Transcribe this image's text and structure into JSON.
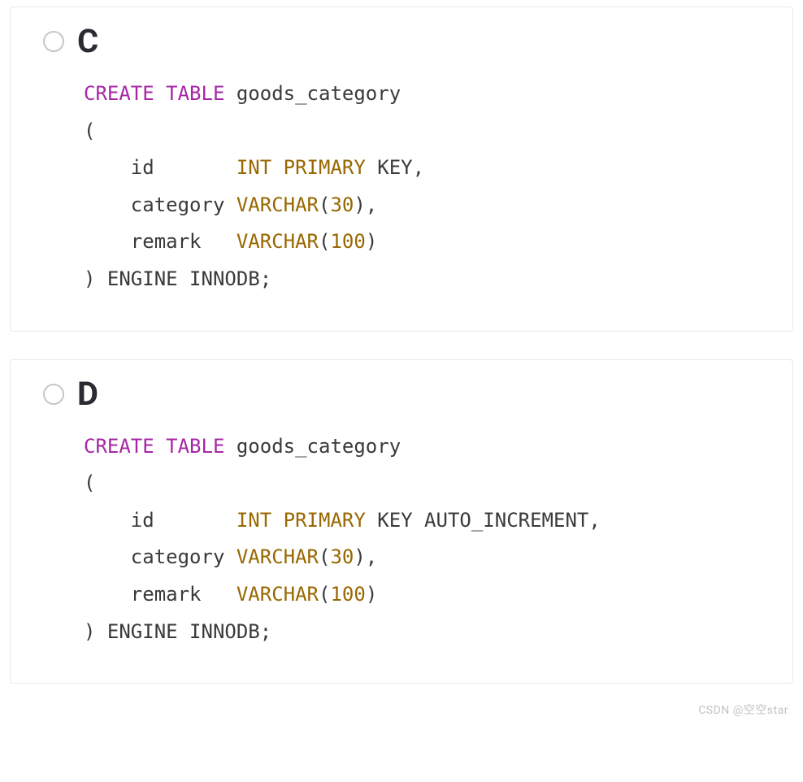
{
  "options": [
    {
      "letter": "C",
      "code_tokens": [
        {
          "t": "CREATE",
          "c": "kw-purple"
        },
        {
          "t": " "
        },
        {
          "t": "TABLE",
          "c": "kw-purple"
        },
        {
          "t": " goods_category\n(\n    id       "
        },
        {
          "t": "INT",
          "c": "kw-brown"
        },
        {
          "t": " "
        },
        {
          "t": "PRIMARY",
          "c": "kw-brown"
        },
        {
          "t": " KEY,\n    category "
        },
        {
          "t": "VARCHAR",
          "c": "kw-brown"
        },
        {
          "t": "("
        },
        {
          "t": "30",
          "c": "kw-num"
        },
        {
          "t": "),\n    remark   "
        },
        {
          "t": "VARCHAR",
          "c": "kw-brown"
        },
        {
          "t": "("
        },
        {
          "t": "100",
          "c": "kw-num"
        },
        {
          "t": ")\n) ENGINE INNODB;"
        }
      ]
    },
    {
      "letter": "D",
      "code_tokens": [
        {
          "t": "CREATE",
          "c": "kw-purple"
        },
        {
          "t": " "
        },
        {
          "t": "TABLE",
          "c": "kw-purple"
        },
        {
          "t": " goods_category\n(\n    id       "
        },
        {
          "t": "INT",
          "c": "kw-brown"
        },
        {
          "t": " "
        },
        {
          "t": "PRIMARY",
          "c": "kw-brown"
        },
        {
          "t": " KEY AUTO_INCREMENT,\n    category "
        },
        {
          "t": "VARCHAR",
          "c": "kw-brown"
        },
        {
          "t": "("
        },
        {
          "t": "30",
          "c": "kw-num"
        },
        {
          "t": "),\n    remark   "
        },
        {
          "t": "VARCHAR",
          "c": "kw-brown"
        },
        {
          "t": "("
        },
        {
          "t": "100",
          "c": "kw-num"
        },
        {
          "t": ")\n) ENGINE INNODB;"
        }
      ]
    }
  ],
  "watermark": "CSDN @空空star"
}
